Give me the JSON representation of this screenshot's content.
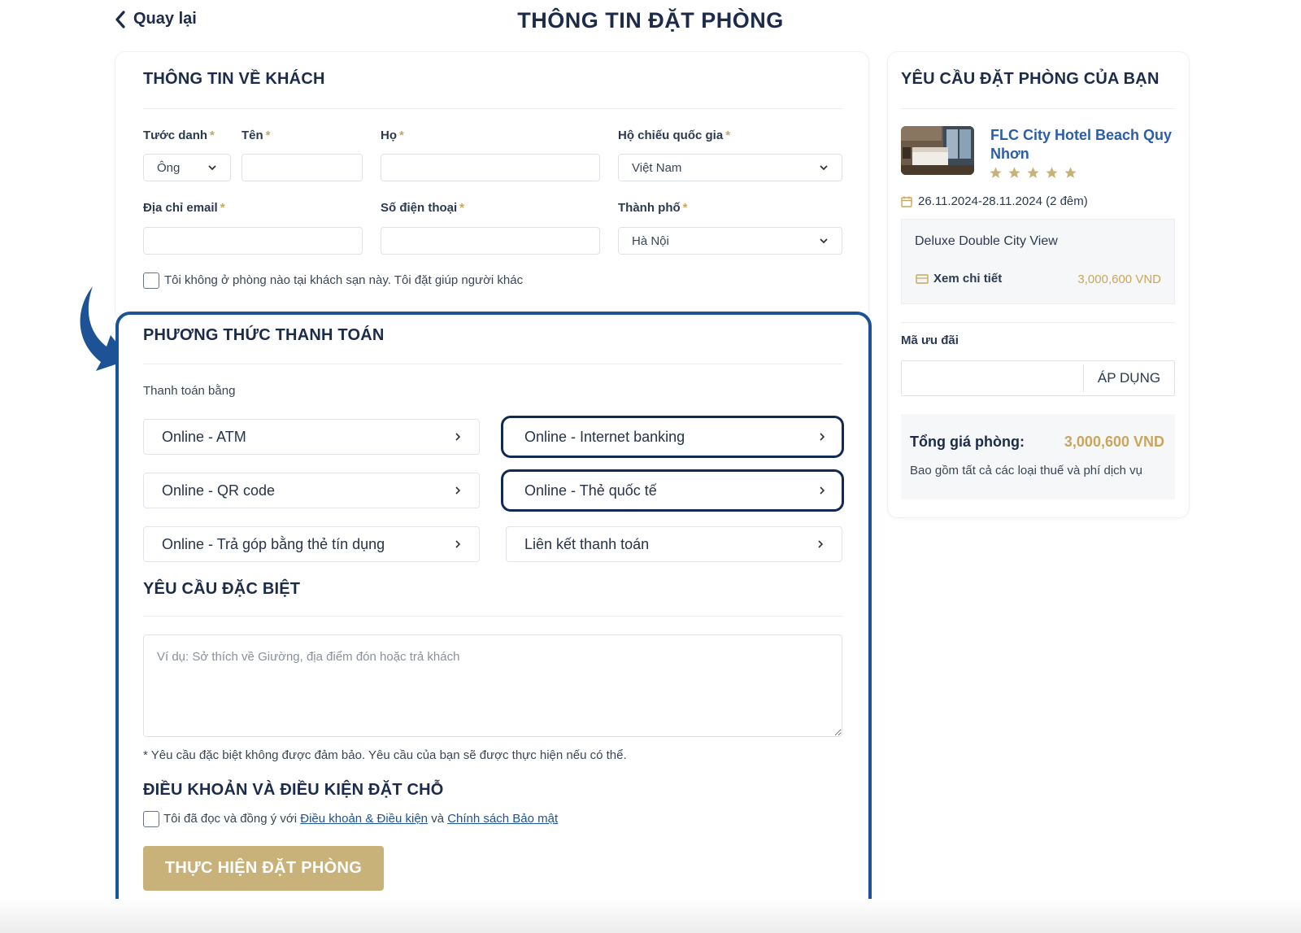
{
  "header": {
    "back_label": "Quay lại",
    "title": "THÔNG TIN ĐẶT PHÒNG"
  },
  "guest": {
    "section_title": "THÔNG TIN VỀ KHÁCH",
    "required_mark": "*",
    "salutation": {
      "label": "Tước danh",
      "value": "Ông"
    },
    "first_name": {
      "label": "Tên",
      "value": ""
    },
    "last_name": {
      "label": "Họ",
      "value": ""
    },
    "nationality": {
      "label": "Hộ chiếu quốc gia",
      "value": "Việt Nam"
    },
    "email": {
      "label": "Địa chỉ email",
      "value": ""
    },
    "phone": {
      "label": "Số điện thoại",
      "value": ""
    },
    "city": {
      "label": "Thành phố",
      "value": "Hà Nội"
    },
    "booking_for_other": "Tôi không ở phòng nào tại khách sạn này. Tôi đặt giúp người khác"
  },
  "payment": {
    "section_title": "PHƯƠNG THỨC THANH TOÁN",
    "pay_with": "Thanh toán bằng",
    "options": [
      {
        "label": "Online - ATM",
        "highlighted": false
      },
      {
        "label": "Online - Internet banking",
        "highlighted": true
      },
      {
        "label": "Online - QR code",
        "highlighted": false
      },
      {
        "label": "Online - Thẻ quốc tế",
        "highlighted": true
      },
      {
        "label": "Online - Trả góp bằng thẻ tín dụng",
        "highlighted": false
      },
      {
        "label": "Liên kết thanh toán",
        "highlighted": false
      }
    ],
    "highlight_color": "#1e5296"
  },
  "special": {
    "section_title": "YÊU CẦU ĐẶC BIỆT",
    "placeholder": "Ví dụ: Sở thích về Giường, địa điểm đón hoặc trả khách",
    "note": "* Yêu cầu đặc biệt không được đảm bảo. Yêu cầu của bạn sẽ được thực hiện nếu có thể."
  },
  "terms": {
    "section_title": "ĐIỀU KHOẢN VÀ ĐIỀU KIỆN ĐẶT CHỖ",
    "prefix": "Tôi đã đọc và đồng ý với",
    "terms_link": "Điều khoản & Điều kiện",
    "and": "và",
    "privacy_link": "Chính sách Bảo mật",
    "submit": "THỰC HIỆN ĐẶT PHÒNG"
  },
  "summary": {
    "title": "YÊU CẦU ĐẶT PHÒNG CỦA BẠN",
    "hotel_name": "FLC City Hotel Beach Quy Nhơn",
    "stars": 5,
    "dates": "26.11.2024-28.11.2024 (2 đêm)",
    "room_name": "Deluxe Double City View",
    "details_label": "Xem chi tiết",
    "room_price": "3,000,600 VND",
    "promo_label": "Mã ưu đãi",
    "promo_value": "",
    "apply_label": "ÁP DỤNG",
    "total_label": "Tổng giá phòng:",
    "total_value": "3,000,600 VND",
    "total_note": "Bao gồm tất cả các loại thuế và phí dịch vụ"
  },
  "colors": {
    "primary": "#1c2b4a",
    "accent_gold": "#c9a65a",
    "button_gold": "#c9b27a",
    "link_blue": "#2c5ea8"
  }
}
